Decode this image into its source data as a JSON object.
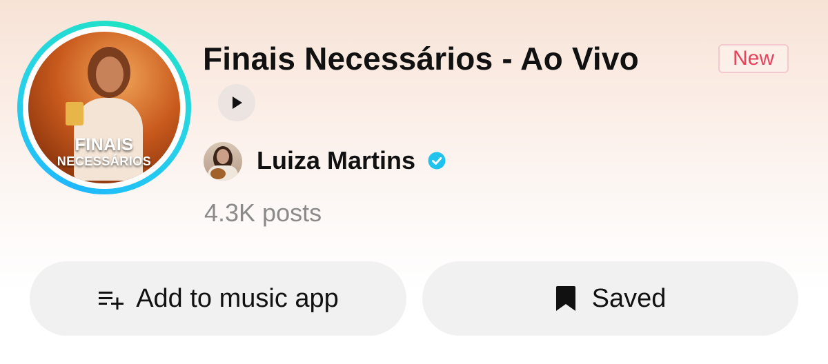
{
  "playlist": {
    "title": "Finais Necessários - Ao Vivo",
    "badge": "New",
    "cover_text_line1": "FINAIS",
    "cover_text_line2": "NECESSÁRIOS",
    "posts": "4.3K posts"
  },
  "artist": {
    "name": "Luiza Martins",
    "verified": true
  },
  "actions": {
    "add_label": "Add to music app",
    "saved_label": "Saved"
  },
  "icons": {
    "play": "play-icon",
    "verified": "verified-badge-icon",
    "add": "playlist-add-icon",
    "saved": "bookmark-icon"
  },
  "colors": {
    "ring_start": "#1fb7ff",
    "ring_end": "#20e3c2",
    "badge_text": "#e8425b",
    "verified": "#20c2ee",
    "button_bg": "#f1f1f1",
    "posts_text": "#8a8a8a"
  }
}
